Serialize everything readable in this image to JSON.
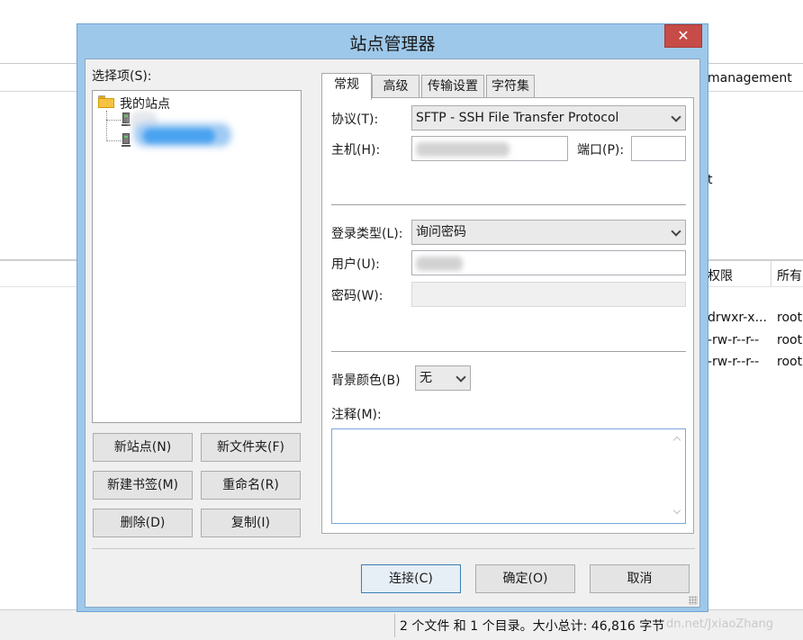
{
  "background": {
    "top_right_text": "management",
    "partial_text": "t",
    "columns": [
      "权限",
      "所有"
    ],
    "rows": [
      {
        "perm": "drwxr-x...",
        "owner": "root"
      },
      {
        "perm": "-rw-r--r--",
        "owner": "root"
      },
      {
        "perm": "-rw-r--r--",
        "owner": "root"
      }
    ],
    "status_text": "2 个文件 和 1 个目录。大小总计: 46,816 字节",
    "watermark": "dn.net/JxiaoZhang"
  },
  "dialog": {
    "title": "站点管理器",
    "close_glyph": "✕",
    "select_entry_label": "选择项(S):",
    "tree": {
      "root_label": "我的站点"
    },
    "left_buttons": {
      "new_site": "新站点(N)",
      "new_folder": "新文件夹(F)",
      "new_bookmark": "新建书签(M)",
      "rename": "重命名(R)",
      "delete": "删除(D)",
      "copy": "复制(I)"
    },
    "tabs": [
      "常规",
      "高级",
      "传输设置",
      "字符集"
    ],
    "active_tab": "常规",
    "general": {
      "protocol_label": "协议(T):",
      "protocol_value": "SFTP - SSH File Transfer Protocol",
      "host_label": "主机(H):",
      "port_label": "端口(P):",
      "port_value": "",
      "logon_type_label": "登录类型(L):",
      "logon_type_value": "询问密码",
      "user_label": "用户(U):",
      "password_label": "密码(W):",
      "bg_color_label": "背景颜色(B)",
      "bg_color_value": "无",
      "comments_label": "注释(M):"
    },
    "footer_buttons": {
      "connect": "连接(C)",
      "ok": "确定(O)",
      "cancel": "取消"
    }
  }
}
